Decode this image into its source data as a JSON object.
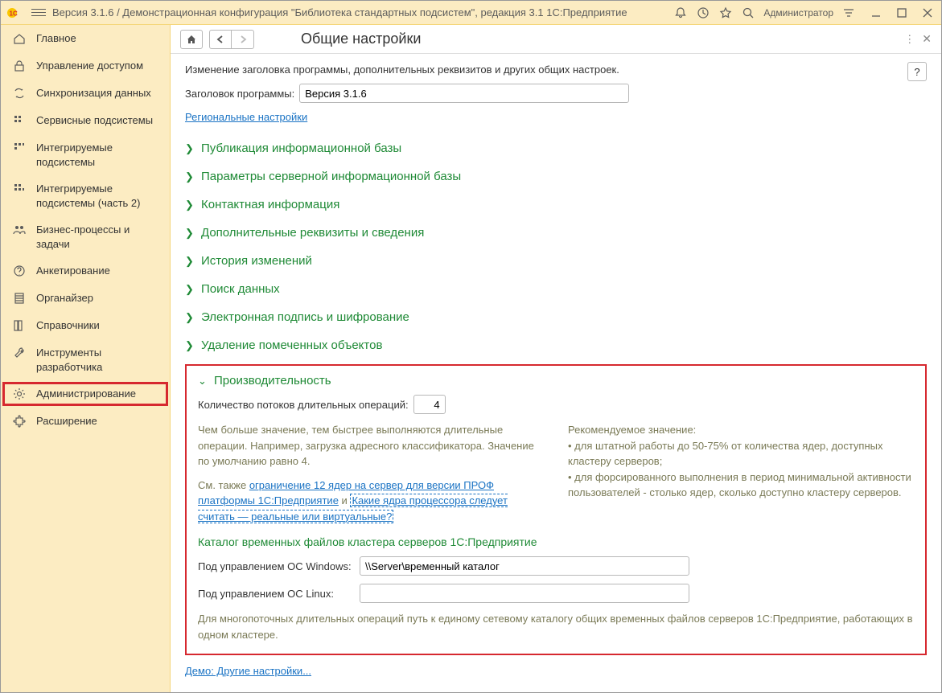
{
  "titlebar": {
    "title": "Версия 3.1.6 / Демонстрационная конфигурация \"Библиотека стандартных подсистем\", редакция 3.1 1С:Предприятие",
    "user": "Администратор"
  },
  "sidebar": {
    "items": [
      {
        "label": "Главное"
      },
      {
        "label": "Управление доступом"
      },
      {
        "label": "Синхронизация данных"
      },
      {
        "label": "Сервисные подсистемы"
      },
      {
        "label": "Интегрируемые подсистемы"
      },
      {
        "label": "Интегрируемые подсистемы (часть 2)"
      },
      {
        "label": "Бизнес-процессы и задачи"
      },
      {
        "label": "Анкетирование"
      },
      {
        "label": "Органайзер"
      },
      {
        "label": "Справочники"
      },
      {
        "label": "Инструменты разработчика"
      },
      {
        "label": "Администрирование"
      },
      {
        "label": "Расширение"
      }
    ]
  },
  "page": {
    "title": "Общие настройки",
    "help": "?",
    "intro": "Изменение заголовка программы, дополнительных реквизитов и других общих настроек.",
    "app_title_label": "Заголовок программы:",
    "app_title_value": "Версия 3.1.6",
    "regional_link": "Региональные настройки",
    "sections": [
      "Публикация информационной базы",
      "Параметры серверной информационной базы",
      "Контактная информация",
      "Дополнительные реквизиты и сведения",
      "История изменений",
      "Поиск данных",
      "Электронная подпись и шифрование",
      "Удаление помеченных объектов"
    ],
    "perf": {
      "title": "Производительность",
      "threads_label": "Количество потоков длительных операций:",
      "threads_value": "4",
      "left_note": "Чем больше значение, тем быстрее выполняются длительные операции. Например, загрузка адресного классификатора. Значение по умолчанию равно 4.",
      "see_also": "См. также ",
      "link1": "ограничение 12 ядер на  сервер для версии ПРОФ платформы 1С:Предприятие",
      "and": " и ",
      "link2": "Какие  ядра процессора следует считать — реальные или виртуальные?",
      "right_title": "Рекомендуемое значение:",
      "right_bullet1": "• для штатной работы до 50-75% от количества ядер, доступных кластеру серверов;",
      "right_bullet2": "• для форсированного выполнения в период минимальной активности пользователей - столько ядер, сколько доступно кластеру серверов.",
      "catalog_title": "Каталог временных файлов кластера серверов 1С:Предприятие",
      "win_label": "Под управлением ОС Windows:",
      "win_value": "\\\\Server\\временный каталог",
      "linux_label": "Под управлением ОС Linux:",
      "linux_value": "",
      "catalog_note": "Для многопоточных длительных операций путь к единому сетевому каталогу общих временных файлов серверов 1С:Предприятие, работающих в одном кластере."
    },
    "demo_link": "Демо: Другие настройки..."
  }
}
